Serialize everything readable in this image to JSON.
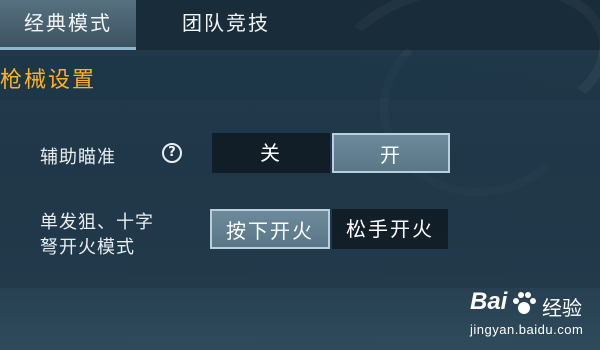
{
  "tabs": [
    {
      "label": "经典模式",
      "active": true
    },
    {
      "label": "团队竞技",
      "active": false
    }
  ],
  "section": {
    "title": "枪械设置"
  },
  "settings": [
    {
      "label": "辅助瞄准",
      "help_icon": "question-circle-icon",
      "options": [
        "关",
        "开"
      ],
      "selected": "开"
    },
    {
      "label_lines": [
        "单发狙、十字",
        "弩开火模式"
      ],
      "options": [
        "按下开火",
        "松手开火"
      ],
      "selected": "按下开火"
    }
  ],
  "watermark": {
    "brand": "Bai",
    "brand_suffix": "经验",
    "url": "jingyan.baidu.com"
  },
  "colors": {
    "accent": "#ffb21e",
    "selected_bg": "#6c8a9b",
    "unselected_bg": "#0f1a22"
  }
}
